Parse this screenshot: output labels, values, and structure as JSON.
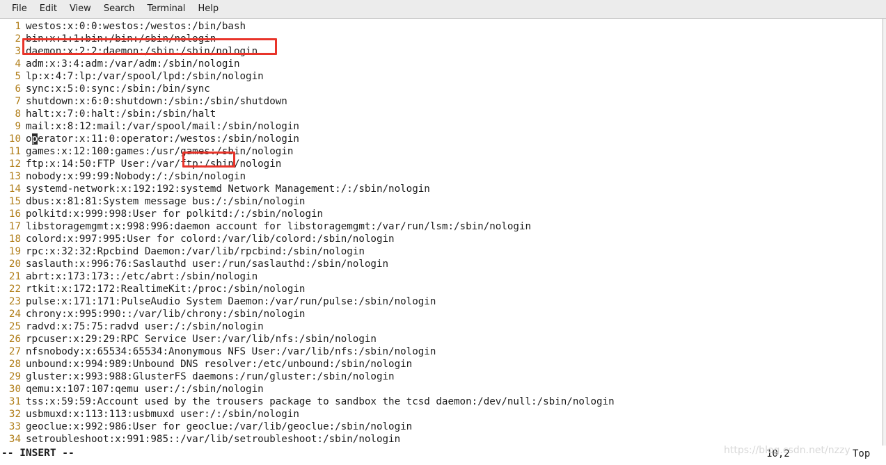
{
  "window": {
    "background": "#ffffff",
    "menubar_background": "#ececec"
  },
  "menubar": {
    "items": [
      {
        "label": "File",
        "name": "menu-file"
      },
      {
        "label": "Edit",
        "name": "menu-edit"
      },
      {
        "label": "View",
        "name": "menu-view"
      },
      {
        "label": "Search",
        "name": "menu-search"
      },
      {
        "label": "Terminal",
        "name": "menu-terminal"
      },
      {
        "label": "Help",
        "name": "menu-help"
      }
    ]
  },
  "editor": {
    "line_number_color": "#b07d18",
    "text_color": "#1c1c1c",
    "cursor_line": 10,
    "cursor_column": 2,
    "cursor_char": "p",
    "lines": [
      {
        "n": "1",
        "text": "westos:x:0:0:westos:/westos:/bin/bash"
      },
      {
        "n": "2",
        "text": "bin:x:1:1:bin:/bin:/sbin/nologin"
      },
      {
        "n": "3",
        "text": "daemon:x:2:2:daemon:/sbin:/sbin/nologin"
      },
      {
        "n": "4",
        "text": "adm:x:3:4:adm:/var/adm:/sbin/nologin"
      },
      {
        "n": "5",
        "text": "lp:x:4:7:lp:/var/spool/lpd:/sbin/nologin"
      },
      {
        "n": "6",
        "text": "sync:x:5:0:sync:/sbin:/bin/sync"
      },
      {
        "n": "7",
        "text": "shutdown:x:6:0:shutdown:/sbin:/sbin/shutdown"
      },
      {
        "n": "8",
        "text": "halt:x:7:0:halt:/sbin:/sbin/halt"
      },
      {
        "n": "9",
        "text": "mail:x:8:12:mail:/var/spool/mail:/sbin/nologin"
      },
      {
        "n": "10",
        "text": "operator:x:11:0:operator:/westos:/sbin/nologin"
      },
      {
        "n": "11",
        "text": "games:x:12:100:games:/usr/games:/sbin/nologin"
      },
      {
        "n": "12",
        "text": "ftp:x:14:50:FTP User:/var/ftp:/sbin/nologin"
      },
      {
        "n": "13",
        "text": "nobody:x:99:99:Nobody:/:/sbin/nologin"
      },
      {
        "n": "14",
        "text": "systemd-network:x:192:192:systemd Network Management:/:/sbin/nologin"
      },
      {
        "n": "15",
        "text": "dbus:x:81:81:System message bus:/:/sbin/nologin"
      },
      {
        "n": "16",
        "text": "polkitd:x:999:998:User for polkitd:/:/sbin/nologin"
      },
      {
        "n": "17",
        "text": "libstoragemgmt:x:998:996:daemon account for libstoragemgmt:/var/run/lsm:/sbin/nologin"
      },
      {
        "n": "18",
        "text": "colord:x:997:995:User for colord:/var/lib/colord:/sbin/nologin"
      },
      {
        "n": "19",
        "text": "rpc:x:32:32:Rpcbind Daemon:/var/lib/rpcbind:/sbin/nologin"
      },
      {
        "n": "20",
        "text": "saslauth:x:996:76:Saslauthd user:/run/saslauthd:/sbin/nologin"
      },
      {
        "n": "21",
        "text": "abrt:x:173:173::/etc/abrt:/sbin/nologin"
      },
      {
        "n": "22",
        "text": "rtkit:x:172:172:RealtimeKit:/proc:/sbin/nologin"
      },
      {
        "n": "23",
        "text": "pulse:x:171:171:PulseAudio System Daemon:/var/run/pulse:/sbin/nologin"
      },
      {
        "n": "24",
        "text": "chrony:x:995:990::/var/lib/chrony:/sbin/nologin"
      },
      {
        "n": "25",
        "text": "radvd:x:75:75:radvd user:/:/sbin/nologin"
      },
      {
        "n": "26",
        "text": "rpcuser:x:29:29:RPC Service User:/var/lib/nfs:/sbin/nologin"
      },
      {
        "n": "27",
        "text": "nfsnobody:x:65534:65534:Anonymous NFS User:/var/lib/nfs:/sbin/nologin"
      },
      {
        "n": "28",
        "text": "unbound:x:994:989:Unbound DNS resolver:/etc/unbound:/sbin/nologin"
      },
      {
        "n": "29",
        "text": "gluster:x:993:988:GlusterFS daemons:/run/gluster:/sbin/nologin"
      },
      {
        "n": "30",
        "text": "qemu:x:107:107:qemu user:/:/sbin/nologin"
      },
      {
        "n": "31",
        "text": "tss:x:59:59:Account used by the trousers package to sandbox the tcsd daemon:/dev/null:/sbin/nologin"
      },
      {
        "n": "32",
        "text": "usbmuxd:x:113:113:usbmuxd user:/:/sbin/nologin"
      },
      {
        "n": "33",
        "text": "geoclue:x:992:986:User for geoclue:/var/lib/geoclue:/sbin/nologin"
      },
      {
        "n": "34",
        "text": "setroubleshoot:x:991:985::/var/lib/setroubleshoot:/sbin/nologin"
      }
    ]
  },
  "annotations": {
    "color": "#e8342a",
    "boxes": [
      {
        "name": "highlight-line-1",
        "target_text": "westos:x:0:0:westos:/westos:/bin/bash"
      },
      {
        "name": "highlight-home-dir",
        "target_text": "/westos:"
      }
    ]
  },
  "statusline": {
    "mode": "-- INSERT --",
    "cursor_position": "10,2",
    "scroll_position": "Top"
  },
  "watermark": {
    "text": "https://blog.csdn.net/nzzy"
  }
}
